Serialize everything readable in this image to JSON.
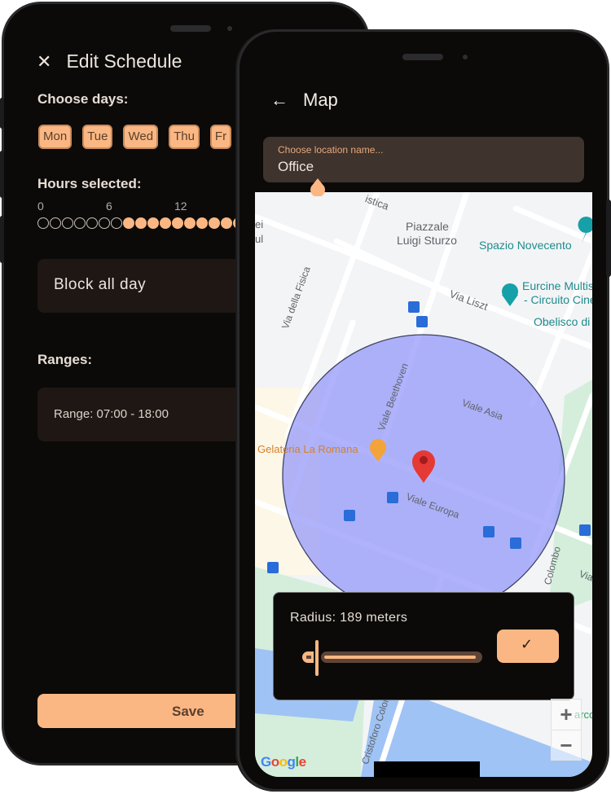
{
  "schedule_screen": {
    "close_icon": "close-icon",
    "title": "Edit Schedule",
    "choose_days_label": "Choose days:",
    "days": [
      "Mon",
      "Tue",
      "Wed",
      "Thu",
      "Fr"
    ],
    "hours_label": "Hours selected:",
    "hours_axis": [
      "0",
      "6",
      "12"
    ],
    "hours_selected_from": 7,
    "hours_visible": 17,
    "block_all_day_label": "Block all day",
    "ranges_label": "Ranges:",
    "ranges": [
      {
        "label": "Range:  07:00 - 18:00"
      }
    ],
    "save_label": "Save"
  },
  "map_screen": {
    "back_icon": "arrow-left-icon",
    "title": "Map",
    "location_field": {
      "placeholder": "Choose location name...",
      "value": "Office"
    },
    "map_labels": {
      "piazzale": "Piazzale",
      "piazzale2": "Luigi Sturzo",
      "spazio": "Spazio Novecento",
      "eurcine": "Eurcine Multis",
      "eurcine2": "- Circuito Cine",
      "obelisco": "Obelisco di",
      "via_liszt": "Via Liszt",
      "via_fisica": "Via della Fisica",
      "viale_beethoven": "Viale Beethoven",
      "viale_asia": "Viale Asia",
      "viale_europa": "Viale Europa",
      "gelateria": "Gelateria La Romana",
      "colombo": "Colombo",
      "cristoforo": "Cristoforo Colombo",
      "istica": "istica",
      "ei": "ei",
      "ul": "ul",
      "arco": "arco",
      "via_partial": "Via"
    },
    "radius_card": {
      "text": "Radius: 189 meters",
      "slider_fraction": 0.05,
      "confirm_icon": "check-icon",
      "confirm_glyph": "✓"
    },
    "zoom_in": "+",
    "zoom_out": "−",
    "google_logo": "Google",
    "colors": {
      "accent": "#fbb783",
      "circle_fill": "#a0a4f8",
      "marker": "#e53935"
    }
  }
}
